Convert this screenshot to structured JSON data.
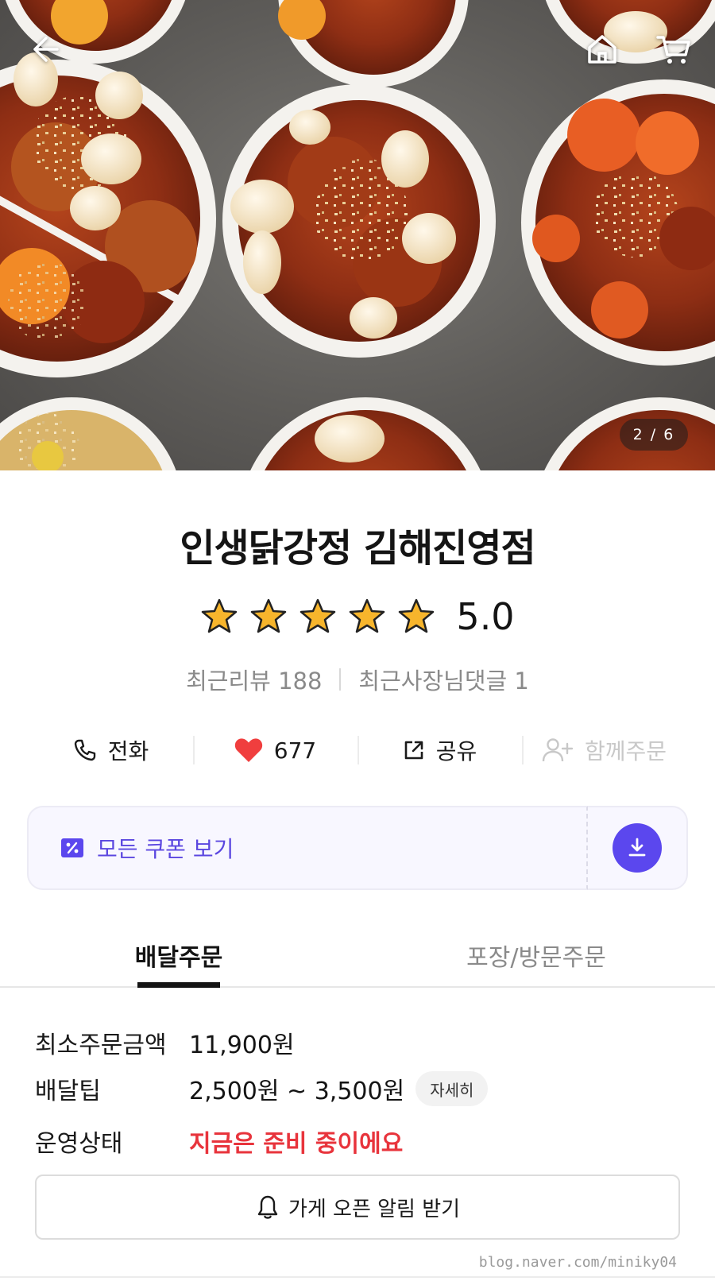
{
  "hero": {
    "photo_counter": "2 / 6",
    "icons": {
      "back": "arrow-left-icon",
      "home": "home-icon",
      "cart": "cart-icon"
    }
  },
  "store": {
    "name": "인생닭강정 김해진영점",
    "rating": "5.0",
    "rating_stars": 5,
    "recent_reviews_label": "최근리뷰 188",
    "owner_replies_label": "최근사장님댓글 1"
  },
  "actions": {
    "call": {
      "label": "전화",
      "icon": "phone-icon"
    },
    "like": {
      "count": "677",
      "icon": "heart-icon",
      "color": "#f03e3e"
    },
    "share": {
      "label": "공유",
      "icon": "share-icon"
    },
    "group_order": {
      "label": "함께주문",
      "icon": "add-person-icon"
    }
  },
  "coupon": {
    "label": "모든 쿠폰 보기",
    "icon": "coupon-icon",
    "download_icon": "download-icon",
    "accent": "#5b47ee"
  },
  "tabs": [
    {
      "label": "배달주문",
      "active": true
    },
    {
      "label": "포장/방문주문",
      "active": false
    }
  ],
  "info": {
    "min_order": {
      "label": "최소주문금액",
      "value": "11,900원"
    },
    "delivery_tip": {
      "label": "배달팁",
      "value": "2,500원 ~ 3,500원",
      "detail_button": "자세히"
    },
    "status": {
      "label": "운영상태",
      "value": "지금은 준비 중이에요",
      "color": "#e8343c"
    }
  },
  "alarm_button": {
    "label": "가게 오픈 알림 받기",
    "icon": "bell-icon"
  },
  "watermark": "blog.naver.com/miniky04"
}
